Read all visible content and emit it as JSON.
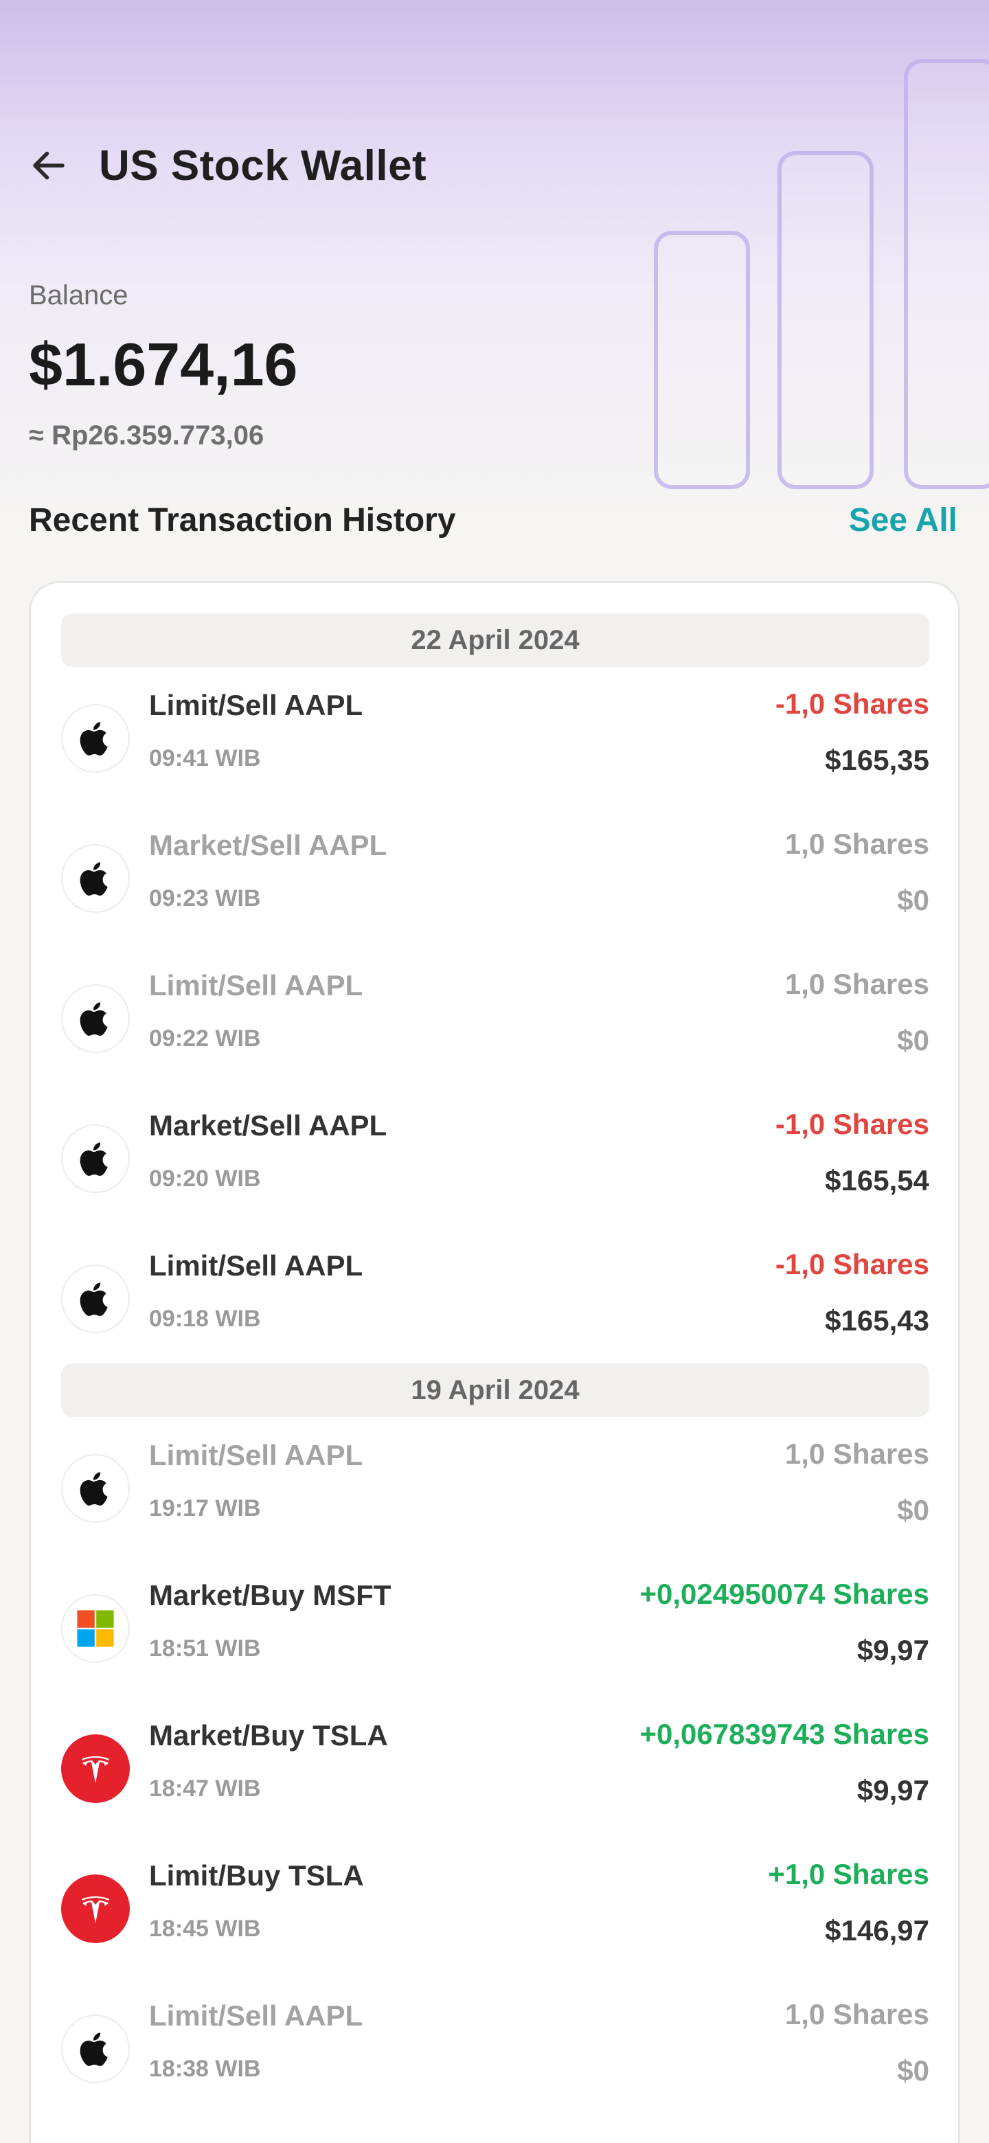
{
  "header": {
    "title": "US Stock Wallet",
    "back_icon": "arrow-left-icon"
  },
  "balance": {
    "label": "Balance",
    "value": "$1.674,16",
    "idr": "≈ Rp26.359.773,06"
  },
  "history": {
    "title": "Recent Transaction History",
    "see_all": "See All",
    "groups": [
      {
        "date": "22 April 2024",
        "items": [
          {
            "name": "Limit/Sell AAPL",
            "time": "09:41 WIB",
            "shares": "-1,0 Shares",
            "amount": "$165,35",
            "logo": "apple-icon",
            "state": "negative"
          },
          {
            "name": "Market/Sell AAPL",
            "time": "09:23 WIB",
            "shares": "1,0 Shares",
            "amount": "$0",
            "logo": "apple-icon",
            "state": "muted"
          },
          {
            "name": "Limit/Sell AAPL",
            "time": "09:22 WIB",
            "shares": "1,0 Shares",
            "amount": "$0",
            "logo": "apple-icon",
            "state": "muted"
          },
          {
            "name": "Market/Sell AAPL",
            "time": "09:20 WIB",
            "shares": "-1,0 Shares",
            "amount": "$165,54",
            "logo": "apple-icon",
            "state": "negative"
          },
          {
            "name": "Limit/Sell AAPL",
            "time": "09:18 WIB",
            "shares": "-1,0 Shares",
            "amount": "$165,43",
            "logo": "apple-icon",
            "state": "negative"
          }
        ]
      },
      {
        "date": "19 April 2024",
        "items": [
          {
            "name": "Limit/Sell AAPL",
            "time": "19:17 WIB",
            "shares": "1,0 Shares",
            "amount": "$0",
            "logo": "apple-icon",
            "state": "muted"
          },
          {
            "name": "Market/Buy MSFT",
            "time": "18:51 WIB",
            "shares": "+0,024950074 Shares",
            "amount": "$9,97",
            "logo": "microsoft-icon",
            "state": "positive"
          },
          {
            "name": "Market/Buy TSLA",
            "time": "18:47 WIB",
            "shares": "+0,067839743 Shares",
            "amount": "$9,97",
            "logo": "tesla-icon",
            "state": "positive"
          },
          {
            "name": "Limit/Buy TSLA",
            "time": "18:45 WIB",
            "shares": "+1,0 Shares",
            "amount": "$146,97",
            "logo": "tesla-icon",
            "state": "positive"
          },
          {
            "name": "Limit/Sell AAPL",
            "time": "18:38 WIB",
            "shares": "1,0 Shares",
            "amount": "$0",
            "logo": "apple-icon",
            "state": "muted"
          }
        ]
      }
    ]
  },
  "colors": {
    "accent": "#19a3ad",
    "negative": "#e0453e",
    "positive": "#1dae5a",
    "muted": "#a3a3a3",
    "tesla_red": "#e5212b"
  }
}
